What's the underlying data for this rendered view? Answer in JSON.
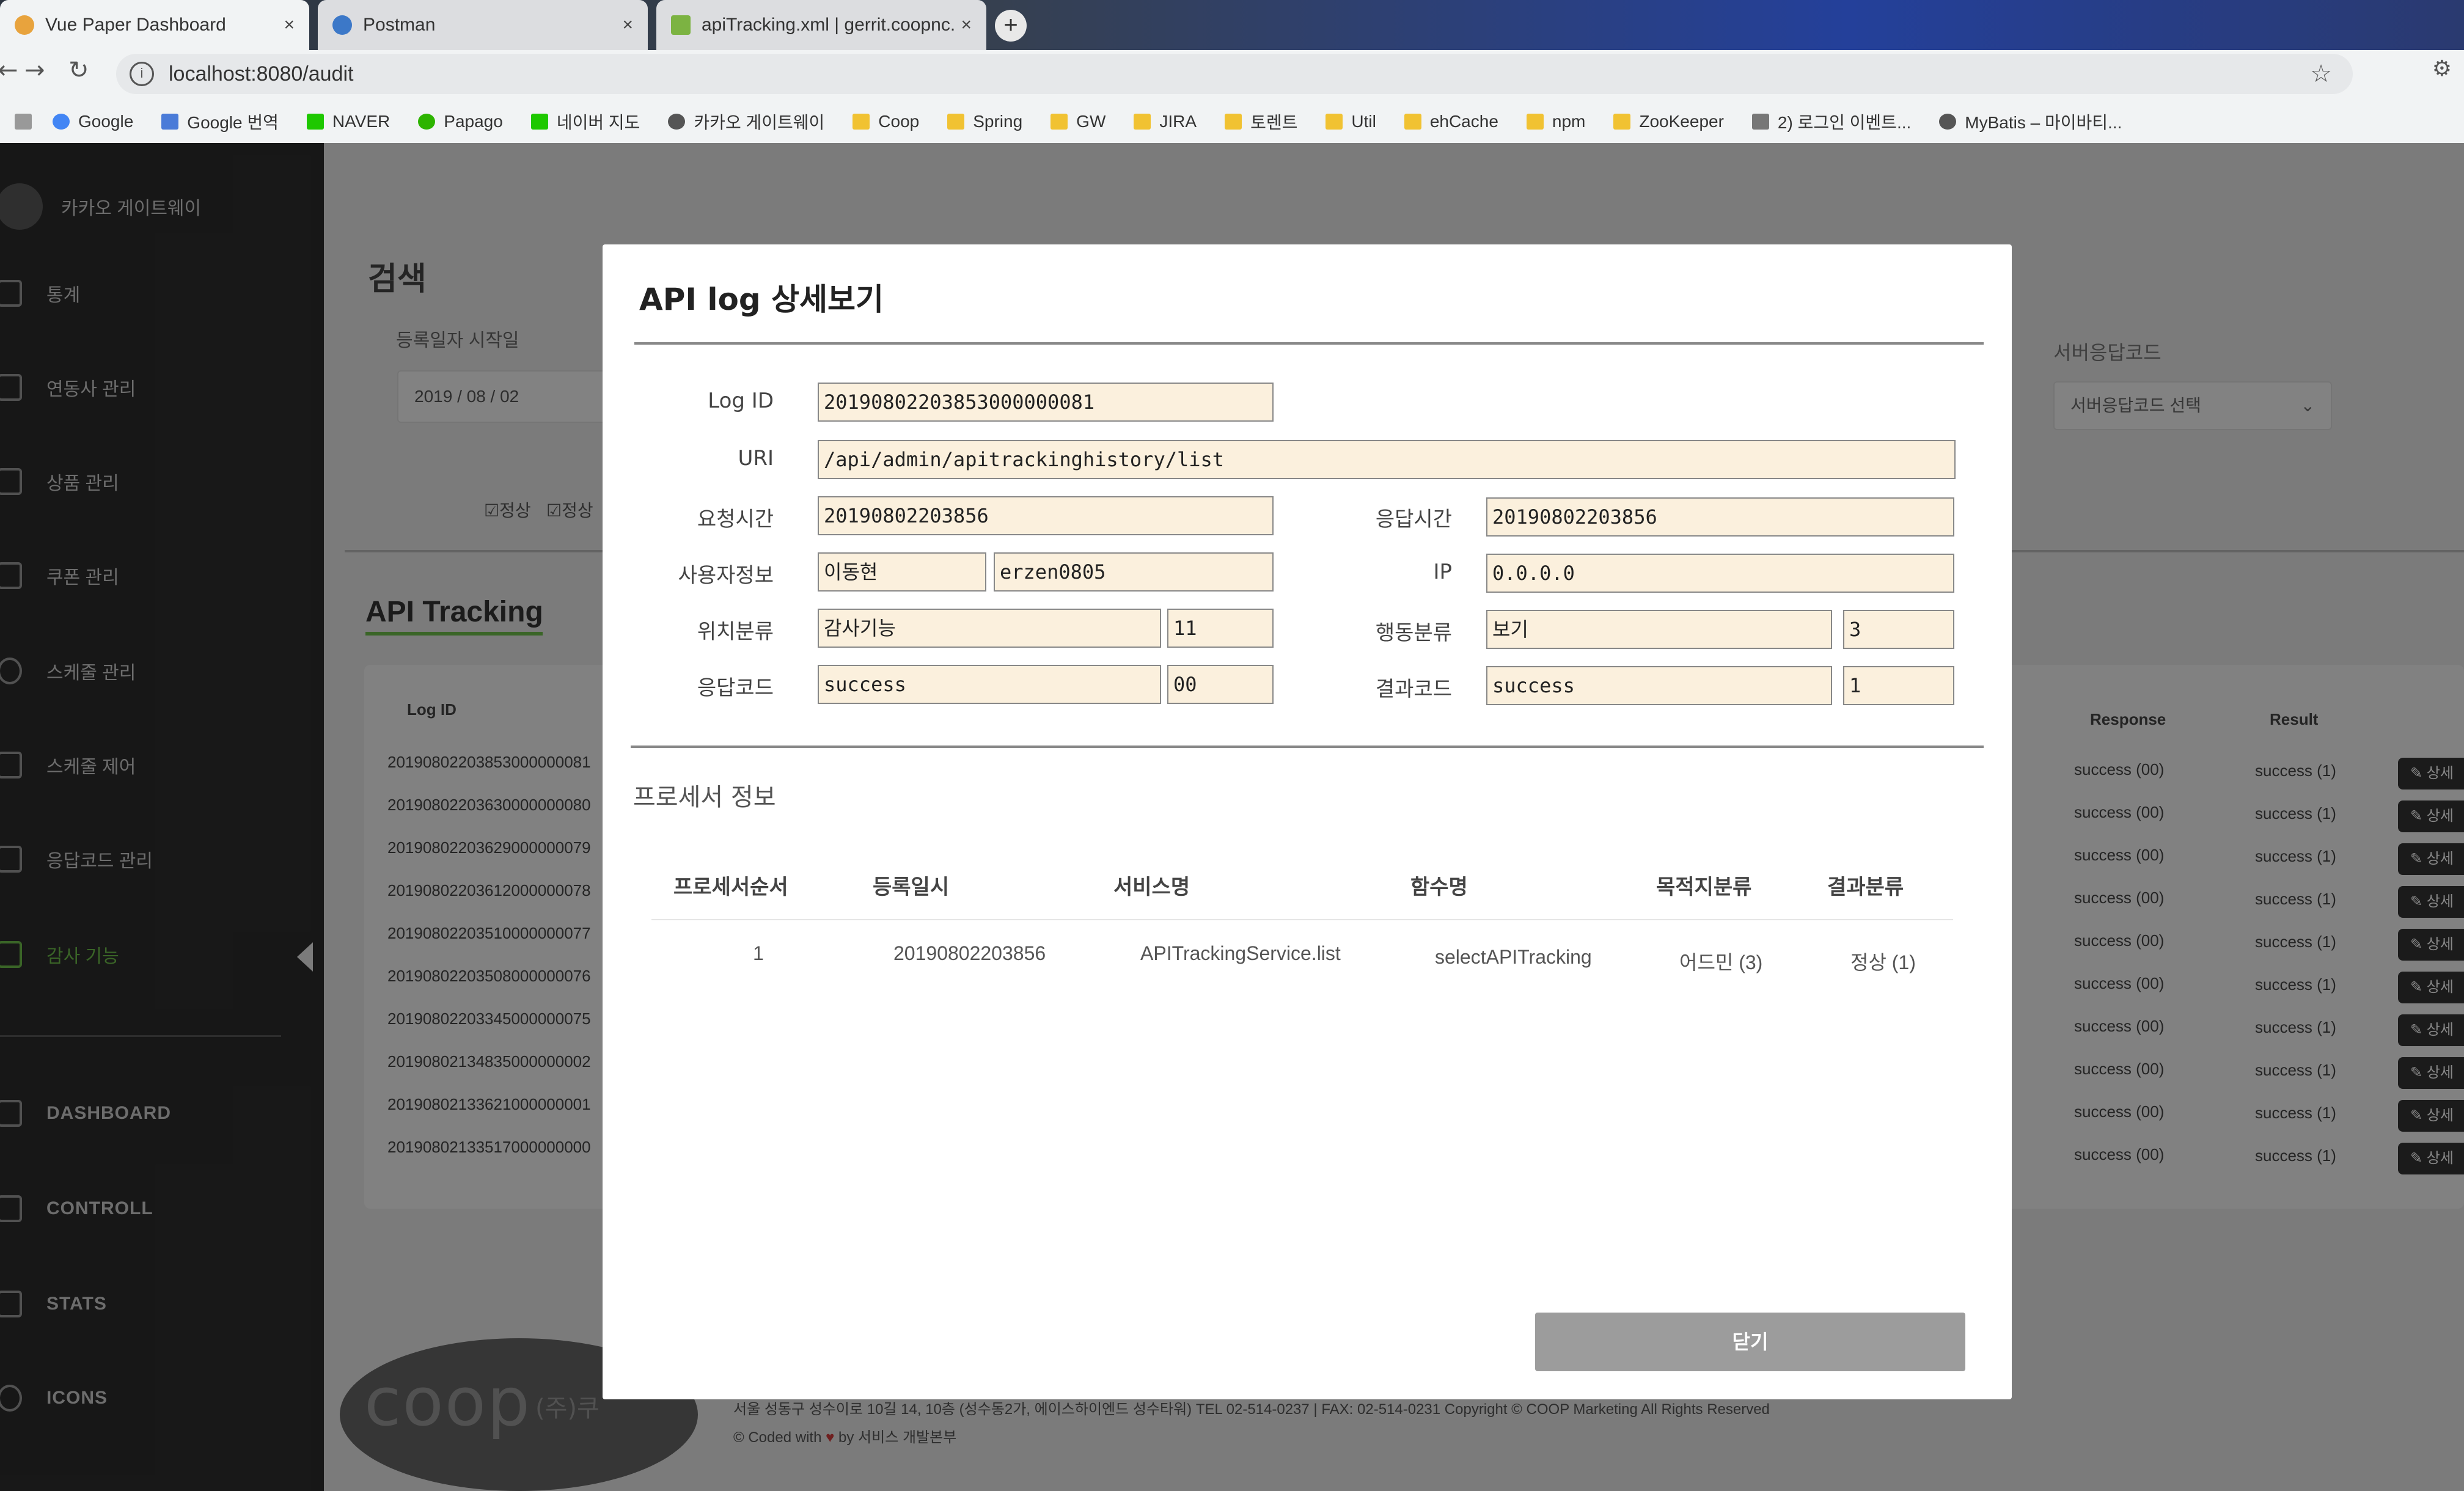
{
  "browser": {
    "tabs": [
      {
        "title": "Vue Paper Dashboard",
        "close": "×"
      },
      {
        "title": "Postman",
        "close": "×"
      },
      {
        "title": "apiTracking.xml | gerrit.coopnc.c",
        "close": "×"
      }
    ],
    "new_tab": "+",
    "url": "localhost:8080/audit",
    "bookmarks": [
      "Google",
      "Google 번역",
      "NAVER",
      "Papago",
      "네이버 지도",
      "카카오 게이트웨이",
      "Coop",
      "Spring",
      "GW",
      "JIRA",
      "토렌트",
      "Util",
      "ehCache",
      "npm",
      "ZooKeeper",
      "2) 로그인 이벤트...",
      "MyBatis – 마이바티..."
    ]
  },
  "sidebar": {
    "brand": "카카오 게이트웨이",
    "items": [
      "통계",
      "연동사 관리",
      "상품 관리",
      "쿠폰 관리",
      "스케줄 관리",
      "스케줄 제어",
      "응답코드 관리",
      "감사 기능"
    ],
    "bottom_items": [
      "DASHBOARD",
      "CONTROLL",
      "STATS",
      "ICONS"
    ]
  },
  "search": {
    "title": "검색",
    "start_date_label": "등록일자 시작일",
    "start_date": "2019 / 08 / 02",
    "checkbox_1": "정상",
    "checkbox_2": "정상",
    "response_code_label": "서버응답코드",
    "response_code_placeholder": "서버응답코드 선택"
  },
  "tracking": {
    "title": "API Tracking",
    "col_log_id": "Log ID",
    "col_response": "Response",
    "col_result": "Result",
    "detail_button": "상세",
    "rows": [
      {
        "log_id": "20190802203853000000081",
        "response": "success (00)",
        "result": "success (1)"
      },
      {
        "log_id": "20190802203630000000080",
        "response": "success (00)",
        "result": "success (1)"
      },
      {
        "log_id": "20190802203629000000079",
        "response": "success (00)",
        "result": "success (1)"
      },
      {
        "log_id": "20190802203612000000078",
        "response": "success (00)",
        "result": "success (1)"
      },
      {
        "log_id": "20190802203510000000077",
        "response": "success (00)",
        "result": "success (1)"
      },
      {
        "log_id": "20190802203508000000076",
        "response": "success (00)",
        "result": "success (1)"
      },
      {
        "log_id": "20190802203345000000075",
        "response": "success (00)",
        "result": "success (1)"
      },
      {
        "log_id": "20190802134835000000002",
        "response": "success (00)",
        "result": "success (1)"
      },
      {
        "log_id": "20190802133621000000001",
        "response": "success (00)",
        "result": "success (1)"
      },
      {
        "log_id": "20190802133517000000000",
        "response": "success (00)",
        "result": "success (1)"
      }
    ]
  },
  "footer": {
    "logo_text": "coop",
    "logo_company": "(주)쿠",
    "address": "서울 성동구 성수이로 10길 14, 10층 (성수동2가, 에이스하이엔드 성수타워) TEL 02-514-0237 | FAX: 02-514-0231 Copyright © COOP Marketing All Rights Reserved",
    "coded_prefix": "© Coded with",
    "coded_heart": "♥",
    "coded_suffix": "by 서비스 개발본부"
  },
  "modal": {
    "title": "API log 상세보기",
    "labels": {
      "log_id": "Log ID",
      "uri": "URI",
      "request_time": "요청시간",
      "response_time": "응답시간",
      "user_info": "사용자정보",
      "ip": "IP",
      "location": "위치분류",
      "action": "행동분류",
      "response_code": "응답코드",
      "result_code": "결과코드"
    },
    "values": {
      "log_id": "20190802203853000000081",
      "uri": "/api/admin/apitrackinghistory/list",
      "request_time": "20190802203856",
      "response_time": "20190802203856",
      "user_name": "이동현",
      "user_id": "erzen0805",
      "ip": "0.0.0.0",
      "location_name": "감사기능",
      "location_code": "11",
      "action_name": "보기",
      "action_code": "3",
      "response_code_name": "success",
      "response_code_value": "00",
      "result_code_name": "success",
      "result_code_value": "1"
    },
    "processor": {
      "section_title": "프로세서 정보",
      "headers": [
        "프로세서순서",
        "등록일시",
        "서비스명",
        "함수명",
        "목적지분류",
        "결과분류"
      ],
      "rows": [
        [
          "1",
          "20190802203856",
          "APITrackingService.list",
          "selectAPITracking",
          "어드민 (3)",
          "정상 (1)"
        ]
      ]
    },
    "close_button": "닫기"
  }
}
